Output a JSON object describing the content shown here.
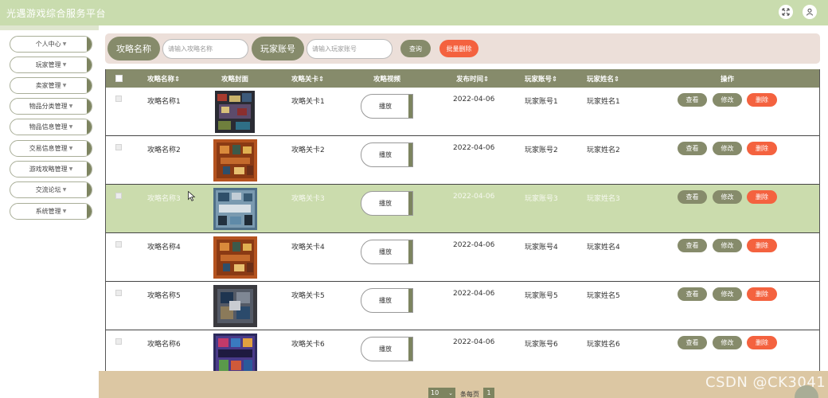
{
  "app": {
    "title": "光遇游戏综合服务平台",
    "fullscreen_icon": "fullscreen-icon",
    "user_icon": "user-icon"
  },
  "sidebar": {
    "items": [
      {
        "label": "个人中心"
      },
      {
        "label": "玩家管理"
      },
      {
        "label": "卖家管理"
      },
      {
        "label": "物品分类管理"
      },
      {
        "label": "物品信息管理"
      },
      {
        "label": "交易信息管理"
      },
      {
        "label": "游戏攻略管理"
      },
      {
        "label": "交流论坛"
      },
      {
        "label": "系统管理"
      }
    ]
  },
  "search": {
    "field1_label": "攻略名称",
    "field1_placeholder": "请输入攻略名称",
    "field2_label": "玩家账号",
    "field2_placeholder": "请输入玩家账号",
    "query_label": "查询",
    "batch_delete_label": "批量删除"
  },
  "table": {
    "columns": [
      "攻略名称",
      "攻略封面",
      "攻略关卡",
      "攻略视频",
      "发布时间",
      "玩家账号",
      "玩家姓名",
      "操作"
    ],
    "sortable": [
      true,
      false,
      true,
      false,
      true,
      true,
      true,
      false
    ],
    "play_label": "播放",
    "view_label": "查看",
    "edit_label": "修改",
    "delete_label": "删除",
    "rows": [
      {
        "name": "攻略名称1",
        "level": "攻略关卡1",
        "date": "2022-04-06",
        "account": "玩家账号1",
        "player": "玩家姓名1",
        "cover": "dark-board"
      },
      {
        "name": "攻略名称2",
        "level": "攻略关卡2",
        "date": "2022-04-06",
        "account": "玩家账号2",
        "player": "玩家姓名2",
        "cover": "orange-board"
      },
      {
        "name": "攻略名称3",
        "level": "攻略关卡3",
        "date": "2022-04-06",
        "account": "玩家账号3",
        "player": "玩家姓名3",
        "cover": "blue-board",
        "highlighted": true
      },
      {
        "name": "攻略名称4",
        "level": "攻略关卡4",
        "date": "2022-04-06",
        "account": "玩家账号4",
        "player": "玩家姓名4",
        "cover": "orange-board"
      },
      {
        "name": "攻略名称5",
        "level": "攻略关卡5",
        "date": "2022-04-06",
        "account": "玩家账号5",
        "player": "玩家姓名5",
        "cover": "box-board"
      },
      {
        "name": "攻略名称6",
        "level": "攻略关卡6",
        "date": "2022-04-06",
        "account": "玩家账号6",
        "player": "玩家姓名6",
        "cover": "purple-board"
      }
    ]
  },
  "pagination": {
    "page_size": "10",
    "per_page_label": "条每页",
    "current_page": "1"
  },
  "watermark": "CSDN @CK3041",
  "colors": {
    "accent": "#868b6b",
    "danger": "#f4623f",
    "highlight_row": "#cbdcad",
    "topbar": "#c9dcae"
  }
}
